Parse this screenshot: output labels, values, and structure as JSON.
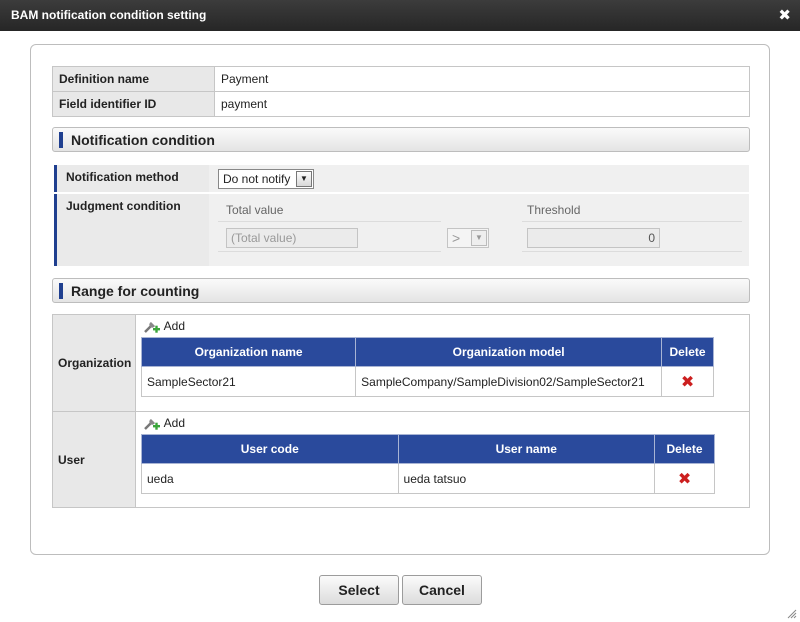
{
  "window": {
    "title": "BAM notification condition setting",
    "close_glyph": "✖"
  },
  "definition": {
    "name_label": "Definition name",
    "name_value": "Payment",
    "field_label": "Field identifier ID",
    "field_value": "payment"
  },
  "sections": {
    "notification": "Notification condition",
    "range": "Range for counting"
  },
  "notification": {
    "method_label": "Notification method",
    "method_value": "Do not notify",
    "judgment_label": "Judgment condition",
    "total_label": "Total value",
    "total_placeholder": "(Total value)",
    "operator": ">",
    "threshold_label": "Threshold",
    "threshold_value": "0"
  },
  "range": {
    "organization": {
      "label": "Organization",
      "add_label": "Add",
      "columns": [
        "Organization name",
        "Organization model",
        "Delete"
      ],
      "rows": [
        {
          "name": "SampleSector21",
          "model": "SampleCompany/SampleDivision02/SampleSector21"
        }
      ]
    },
    "user": {
      "label": "User",
      "add_label": "Add",
      "columns": [
        "User code",
        "User name",
        "Delete"
      ],
      "rows": [
        {
          "code": "ueda",
          "name": "ueda tatsuo"
        }
      ]
    }
  },
  "buttons": {
    "select": "Select",
    "cancel": "Cancel"
  },
  "colors": {
    "accent": "#1f3f8f",
    "header_bg": "#2a4a9c",
    "delete": "#cc1f1f"
  },
  "icons": {
    "close": "close-icon",
    "add": "add-icon",
    "delete": "delete-icon",
    "dropdown": "chevron-down-icon"
  }
}
